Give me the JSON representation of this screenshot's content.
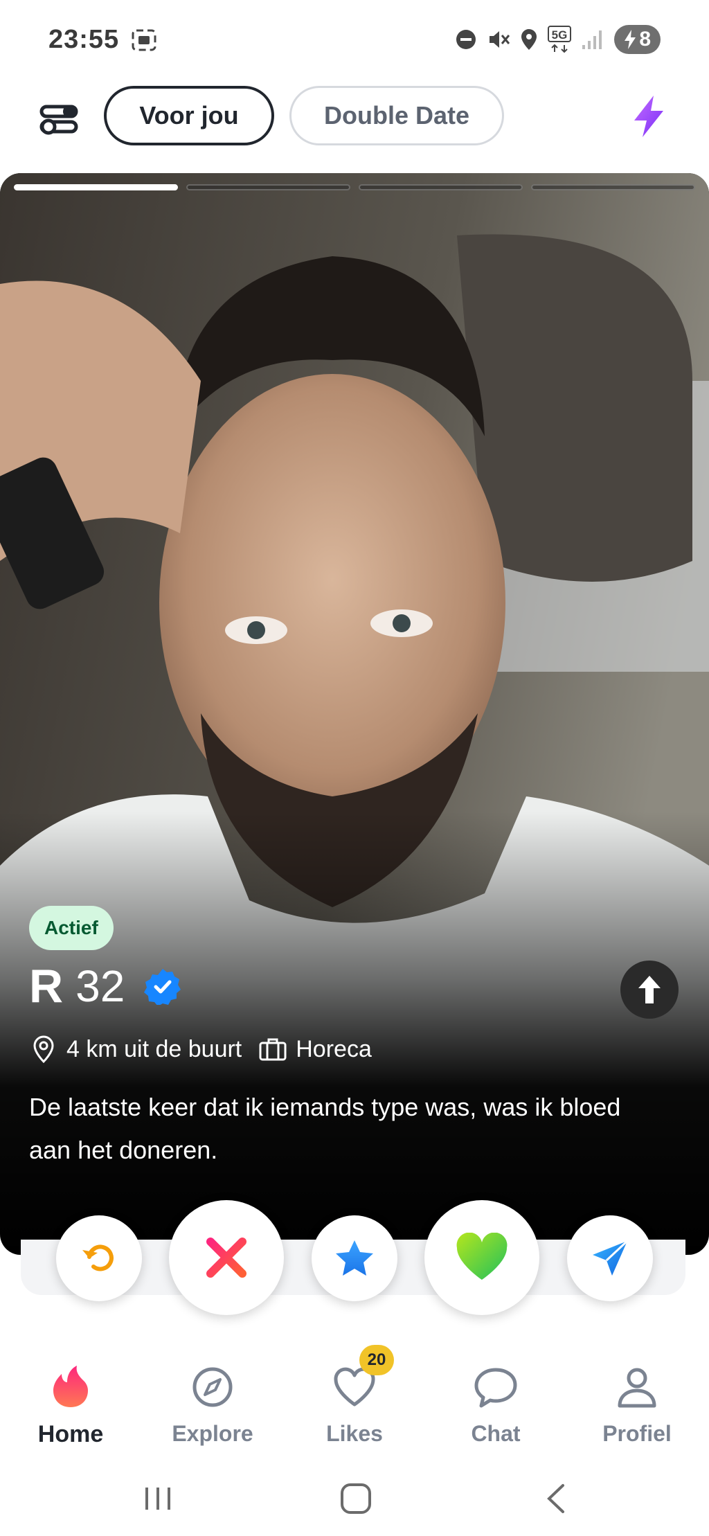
{
  "status_bar": {
    "time": "23:55",
    "network": "5G",
    "battery": "8",
    "icons": [
      "screenshot-icon",
      "do-not-disturb-icon",
      "mute-icon",
      "location-icon",
      "5g-icon",
      "signal-icon",
      "battery-icon"
    ]
  },
  "top_bar": {
    "tabs": [
      {
        "label": "Voor jou",
        "selected": true
      },
      {
        "label": "Double Date",
        "selected": false
      }
    ],
    "filter_icon": "filter-sliders-icon",
    "boost_icon": "lightning-bolt-icon",
    "boost_color": "#a855f7"
  },
  "card": {
    "photo_count": 4,
    "active_photo": 1,
    "status_badge": "Actief",
    "name": "R",
    "age": "32",
    "verified": true,
    "distance": "4 km uit de buurt",
    "job": "Horeca",
    "bio": "De laatste keer dat ik iemands type was, was ik bloed aan het doneren."
  },
  "actions": [
    {
      "name": "rewind",
      "icon": "rewind-icon",
      "color": "#f59e0b"
    },
    {
      "name": "nope",
      "icon": "x-icon",
      "color": "#fd267d"
    },
    {
      "name": "super-like",
      "icon": "star-icon",
      "color": "#2b8ff8"
    },
    {
      "name": "like",
      "icon": "heart-icon",
      "color": "#4cd964"
    },
    {
      "name": "boost-send",
      "icon": "send-icon",
      "color": "#1a8ff5"
    }
  ],
  "bottom_nav": {
    "items": [
      {
        "label": "Home",
        "icon": "flame-icon",
        "active": true
      },
      {
        "label": "Explore",
        "icon": "compass-icon",
        "active": false
      },
      {
        "label": "Likes",
        "icon": "heart-outline-icon",
        "active": false,
        "badge": "20"
      },
      {
        "label": "Chat",
        "icon": "chat-bubble-icon",
        "active": false
      },
      {
        "label": "Profiel",
        "icon": "person-icon",
        "active": false
      }
    ]
  },
  "colors": {
    "brand_gradient_start": "#fd267d",
    "brand_gradient_end": "#ff7854",
    "active_badge_bg": "#d4f7e0",
    "active_badge_text": "#065a32",
    "likes_badge": "#f1c328",
    "verified": "#1786ff"
  }
}
